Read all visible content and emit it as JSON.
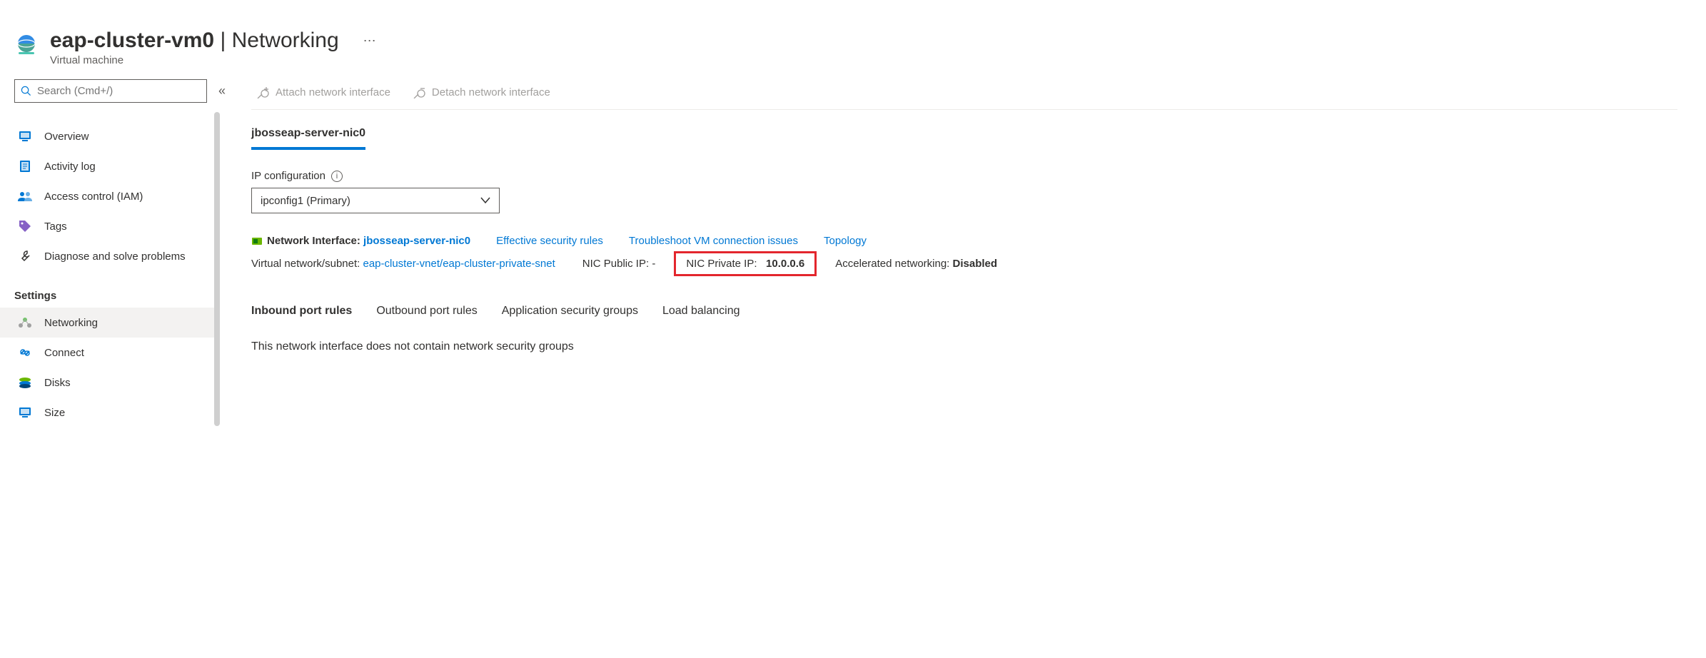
{
  "header": {
    "title_resource": "eap-cluster-vm0",
    "title_section": "Networking",
    "subtitle": "Virtual machine"
  },
  "search": {
    "placeholder": "Search (Cmd+/)"
  },
  "sidebar": {
    "items": [
      {
        "label": "Overview"
      },
      {
        "label": "Activity log"
      },
      {
        "label": "Access control (IAM)"
      },
      {
        "label": "Tags"
      },
      {
        "label": "Diagnose and solve problems"
      }
    ],
    "settings_header": "Settings",
    "settings_items": [
      {
        "label": "Networking",
        "selected": true
      },
      {
        "label": "Connect"
      },
      {
        "label": "Disks"
      },
      {
        "label": "Size"
      }
    ]
  },
  "toolbar": {
    "attach": "Attach network interface",
    "detach": "Detach network interface"
  },
  "nic": {
    "tab_name": "jbosseap-server-nic0",
    "ip_config_label": "IP configuration",
    "ip_config_value": "ipconfig1 (Primary)",
    "ni_label": "Network Interface:",
    "ni_link": "jbosseap-server-nic0",
    "effective_rules": "Effective security rules",
    "troubleshoot": "Troubleshoot VM connection issues",
    "topology": "Topology",
    "vnet_label": "Virtual network/subnet:",
    "vnet_link": "eap-cluster-vnet/eap-cluster-private-snet",
    "public_ip_label": "NIC Public IP:",
    "public_ip_value": "-",
    "private_ip_label": "NIC Private IP:",
    "private_ip_value": "10.0.0.6",
    "accel_label": "Accelerated networking:",
    "accel_value": "Disabled"
  },
  "tabs": {
    "inbound": "Inbound port rules",
    "outbound": "Outbound port rules",
    "asg": "Application security groups",
    "lb": "Load balancing"
  },
  "empty_state": "This network interface does not contain network security groups"
}
